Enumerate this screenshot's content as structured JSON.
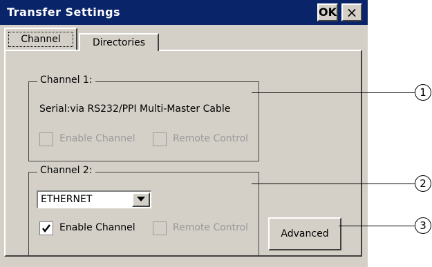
{
  "window": {
    "title": "Transfer Settings",
    "ok_label": "OK",
    "close_label": "×"
  },
  "tabs": [
    {
      "label": "Channel",
      "active": true
    },
    {
      "label": "Directories",
      "active": false
    }
  ],
  "channel1": {
    "title": "Channel 1:",
    "description": "Serial:via RS232/PPI Multi-Master Cable",
    "enable_label": "Enable Channel",
    "enable_checked": false,
    "remote_label": "Remote Control",
    "remote_checked": false
  },
  "channel2": {
    "title": "Channel 2:",
    "protocol_value": "ETHERNET",
    "enable_label": "Enable Channel",
    "enable_checked": true,
    "remote_label": "Remote Control",
    "remote_checked": false
  },
  "advanced_label": "Advanced",
  "callouts": [
    "1",
    "2",
    "3"
  ]
}
